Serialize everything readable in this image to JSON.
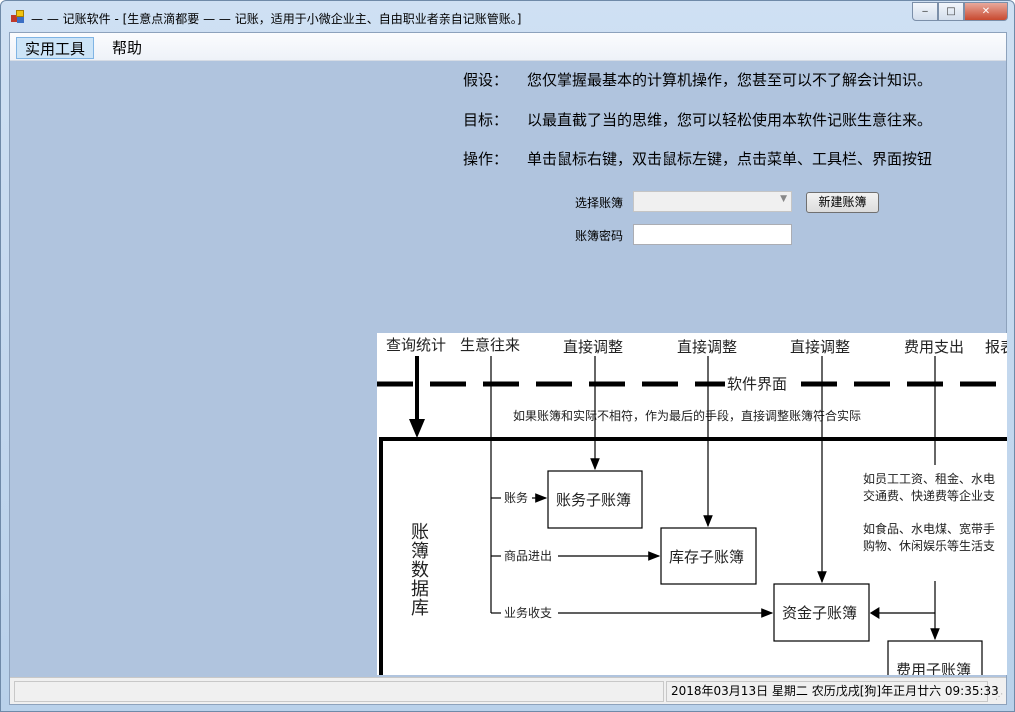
{
  "window": {
    "title": "— — 记账软件 - [生意点滴都要 — — 记账，适用于小微企业主、自由职业者亲自记账管账。]",
    "controls": {
      "minimize": "‒",
      "maximize": "□",
      "close": "✕"
    }
  },
  "menu": [
    "实用工具",
    "帮助"
  ],
  "info": [
    {
      "label": "假设：",
      "text": "您仅掌握最基本的计算机操作，您甚至可以不了解会计知识。"
    },
    {
      "label": "目标：",
      "text": "以最直截了当的思维，您可以轻松使用本软件记账生意往来。"
    },
    {
      "label": "操作：",
      "text": "单击鼠标右键，双击鼠标左键，点击菜单、工具栏、界面按钮"
    }
  ],
  "form": {
    "select_label": "选择账簿",
    "select_value": "",
    "new_button": "新建账簿",
    "password_label": "账簿密码",
    "password_value": ""
  },
  "diagram": {
    "top_labels": [
      "查询统计",
      "生意往来",
      "直接调整",
      "直接调整",
      "直接调整",
      "费用支出",
      "报表"
    ],
    "boundary": "软件界面",
    "note": "如果账簿和实际不相符，作为最后的手段，直接调整账簿符合实际",
    "database": "账簿数据库",
    "branches": [
      "账务",
      "商品进出",
      "业务收支"
    ],
    "boxes": [
      "账务子账簿",
      "库存子账簿",
      "资金子账簿",
      "费用子账簿"
    ],
    "expense_notes": [
      "如员工工资、租金、水电",
      "交通费、快递费等企业支",
      "如食品、水电煤、宽带手",
      "购物、休闲娱乐等生活支"
    ]
  },
  "status": {
    "left": "",
    "datetime": "2018年03月13日  星期二  农历戊戌[狗]年正月廿六 09:35:33"
  }
}
